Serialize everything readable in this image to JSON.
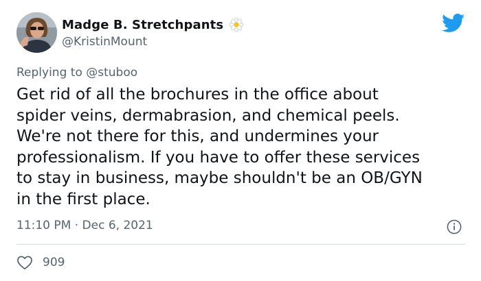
{
  "author": {
    "display_name": "Madge B. Stretchpants",
    "handle": "@KristinMount",
    "name_emoji": "flower-icon",
    "avatar": "avatar"
  },
  "brand_icon": "twitter-bird-icon",
  "reply": {
    "prefix": "Replying to",
    "mention": "@stuboo"
  },
  "tweet": {
    "lines": [
      "Get rid of all the brochures in the office about",
      "spider veins, dermabrasion, and chemical peels.",
      "We're not there for this, and undermines your",
      "professionalism. If you have to offer these services",
      "to stay in business, maybe shouldn't be an OB/GYN",
      "in the first place."
    ]
  },
  "meta": {
    "timestamp": "11:10 PM · Dec 6, 2021",
    "info_icon": "info-icon"
  },
  "stats": {
    "likes": "909",
    "like_icon": "heart-icon"
  },
  "colors": {
    "brand_blue": "#1d9bf0",
    "text_primary": "#0f1419",
    "text_secondary": "#536471",
    "divider": "#cfd9de"
  }
}
